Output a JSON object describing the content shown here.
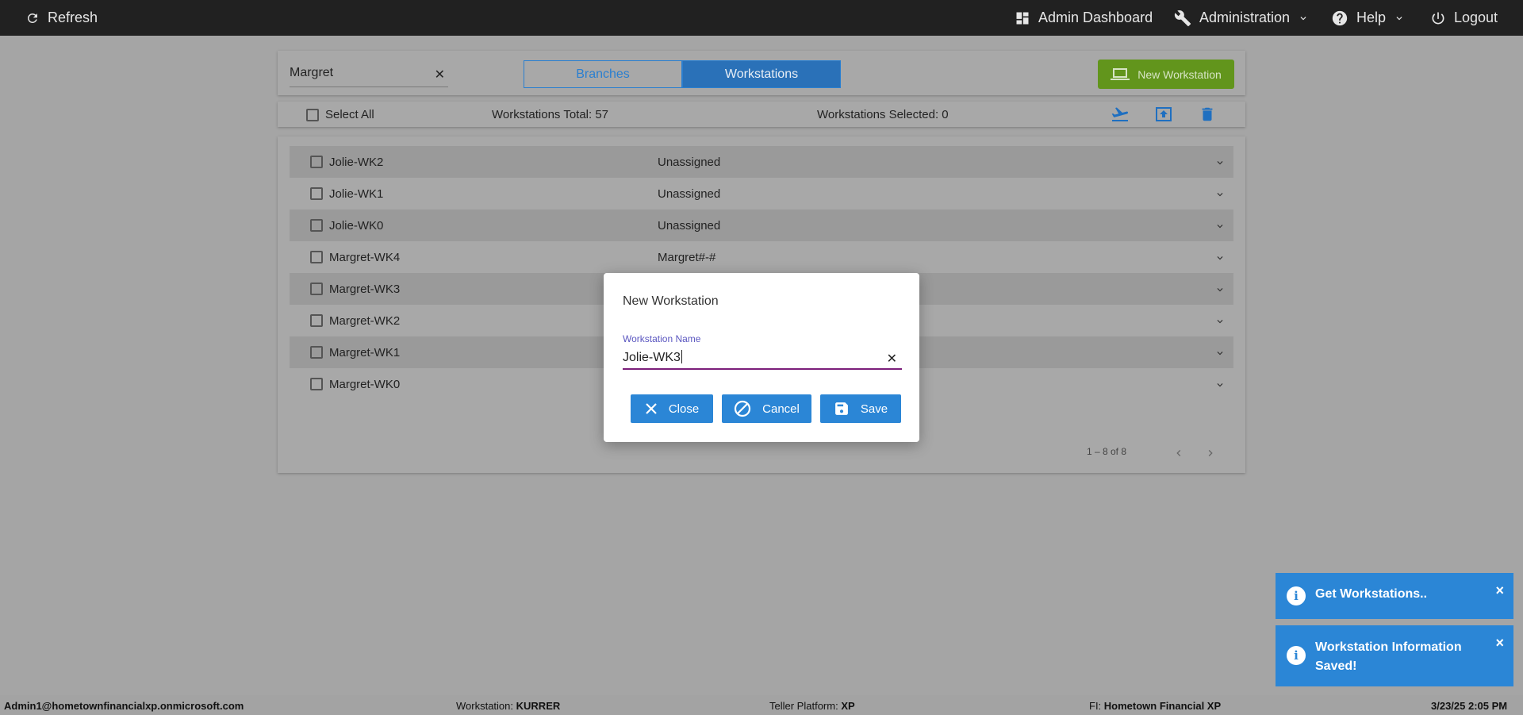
{
  "topbar": {
    "refresh": "Refresh",
    "admin_dashboard": "Admin Dashboard",
    "administration": "Administration",
    "help": "Help",
    "logout": "Logout"
  },
  "toolbar": {
    "search_value": "Margret",
    "tabs": [
      "Branches",
      "Workstations"
    ],
    "active_tab": "Workstations",
    "new_workstation": "New Workstation"
  },
  "selection": {
    "select_all": "Select All",
    "total": "Workstations Total: 57",
    "selected": "Workstations Selected: 0"
  },
  "rows": [
    {
      "name": "Jolie-WK2",
      "assign": "Unassigned"
    },
    {
      "name": "Jolie-WK1",
      "assign": "Unassigned"
    },
    {
      "name": "Jolie-WK0",
      "assign": "Unassigned"
    },
    {
      "name": "Margret-WK4",
      "assign": "Margret#-#"
    },
    {
      "name": "Margret-WK3",
      "assign": ""
    },
    {
      "name": "Margret-WK2",
      "assign": ""
    },
    {
      "name": "Margret-WK1",
      "assign": ""
    },
    {
      "name": "Margret-WK0",
      "assign": ""
    }
  ],
  "pager": {
    "range": "1 – 8 of 8"
  },
  "dialog": {
    "title": "New Workstation",
    "field_label": "Workstation Name",
    "field_value": "Jolie-WK3",
    "close": "Close",
    "cancel": "Cancel",
    "save": "Save"
  },
  "toasts": [
    {
      "msg": "Get Workstations.."
    },
    {
      "msg": "Workstation Information Saved!"
    }
  ],
  "status": {
    "user": "Admin1@hometownfinancialxp.onmicrosoft.com",
    "workstation_label": "Workstation:",
    "workstation": "KURRER",
    "teller_label": "Teller Platform:",
    "teller": "XP",
    "fi_label": "FI:",
    "fi": "Hometown Financial XP",
    "datetime": "3/23/25 2:05 PM"
  },
  "colors": {
    "accent": "#2b86d6",
    "topbar": "#212121",
    "new_button": "#62951c",
    "field_underline": "#7b1f7a"
  }
}
